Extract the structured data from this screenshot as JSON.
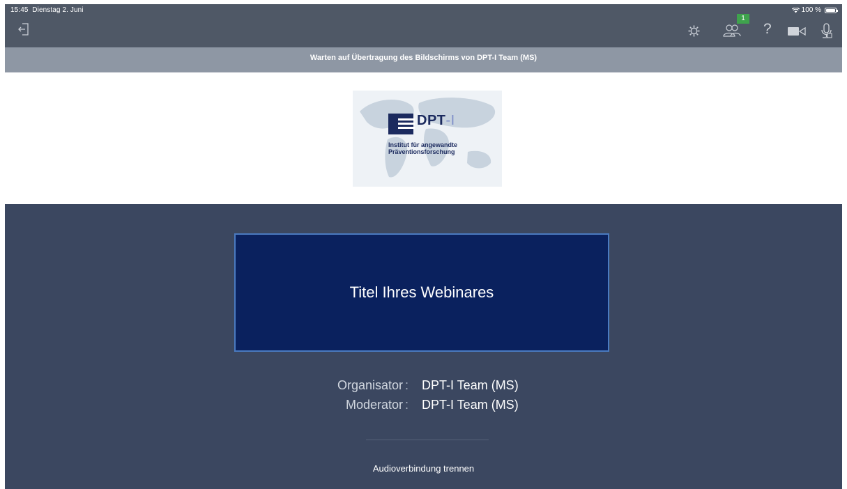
{
  "status_bar": {
    "time": "15:45",
    "date": "Dienstag 2. Juni",
    "battery": "100 %"
  },
  "toolbar": {
    "participants_count": "1",
    "help_glyph": "?",
    "icons": [
      "leave-icon",
      "gear-icon",
      "participants-icon",
      "help-icon",
      "camera-icon",
      "microphone-icon"
    ]
  },
  "banner": {
    "text": "Warten auf Übertragung des Bildschirms von DPT-I Team (MS)"
  },
  "logo": {
    "name": "DPT",
    "name_suffix": "-I",
    "subtitle_line1": "Institut für angewandte",
    "subtitle_line2": "Präventionsforschung"
  },
  "webinar": {
    "title": "Titel Ihres Webinares",
    "organizer_label": "Organisator",
    "organizer_value": "DPT-I Team (MS)",
    "moderator_label": "Moderator",
    "moderator_value": "DPT-I Team (MS)",
    "separator": ":",
    "audio_disconnect": "Audioverbindung trennen"
  },
  "colors": {
    "toolbar_bg": "#4f5866",
    "banner_bg": "#8e97a4",
    "main_bg": "#3b4760",
    "title_box_bg": "#0a215e",
    "badge_green": "#3fa34d"
  }
}
